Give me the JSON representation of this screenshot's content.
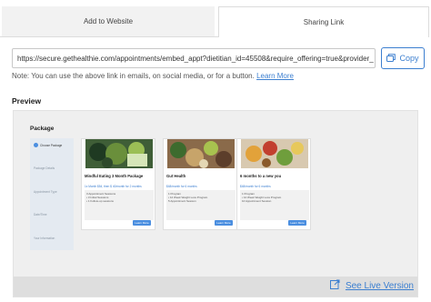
{
  "tabs": {
    "add_to_website": "Add to Website",
    "sharing_link": "Sharing Link"
  },
  "share": {
    "url": "https://secure.gethealthie.com/appointments/embed_appt?dietitian_id=45508&require_offering=true&provider_",
    "copy_label": "Copy",
    "note_text": "Note: You can use the above link in emails, on social media, or for a button.",
    "learn_more": "Learn More"
  },
  "preview": {
    "title": "Preview",
    "package_title": "Package",
    "steps": [
      "Choose Package",
      "Package Details",
      "Appointment Type",
      "Date/Time",
      "Your Information"
    ],
    "cards": [
      {
        "name": "Mindful Eating 3 Month Package",
        "price": "1x Month $54, then $ 40/month for 2 months",
        "details_1": "3 Appointment Sessions",
        "details_2": "• 3 Initial Sessions",
        "details_3": "• 1 Follow-up sessions",
        "button": "Learn More"
      },
      {
        "name": "Gut Health",
        "price": "$48/month for 6 months",
        "details_1": "1 Program",
        "details_2": "• 12 Week Weight Loss Program",
        "details_3": "5 Appointment Session",
        "button": "Learn More"
      },
      {
        "name": "6 months to a new you",
        "price": "$48/month for 6 months",
        "details_1": "1 Program",
        "details_2": "• 12 Week Weight Loss Program",
        "details_3": "10 Appointment Session",
        "button": "Learn More"
      }
    ],
    "see_live_version": "See Live Version"
  },
  "colors": {
    "accent": "#3c7fd0",
    "button": "#4a8ee0"
  },
  "icons": {
    "copy": "copy-icon",
    "external": "external-link-icon"
  }
}
